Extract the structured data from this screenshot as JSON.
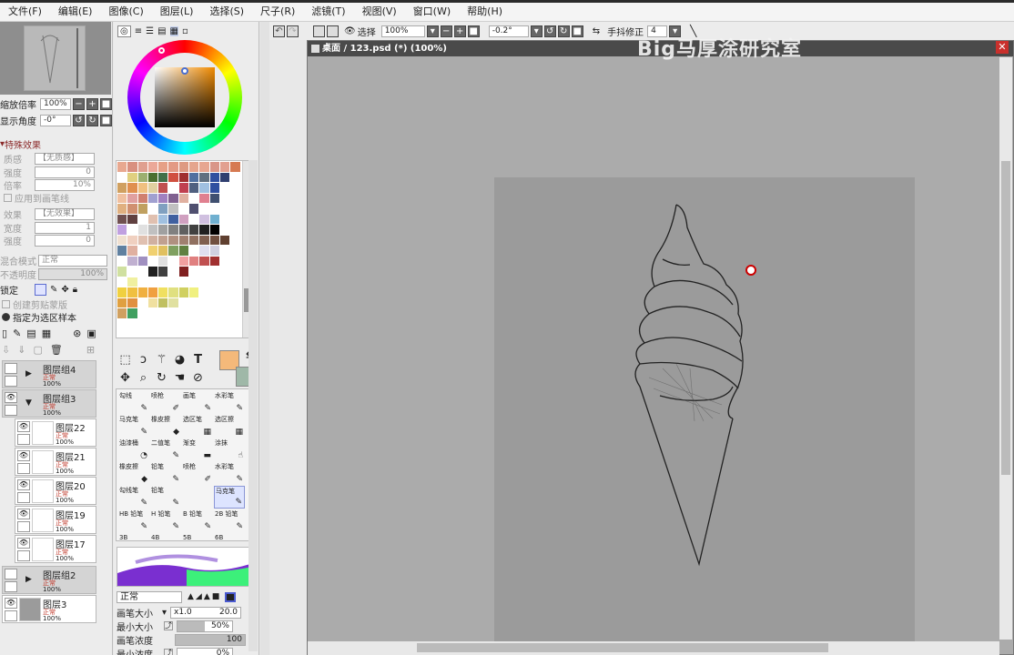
{
  "menu": [
    "文件(F)",
    "编辑(E)",
    "图像(C)",
    "图层(L)",
    "选择(S)",
    "尺子(R)",
    "滤镜(T)",
    "视图(V)",
    "窗口(W)",
    "帮助(H)"
  ],
  "navigator": {
    "zoom_label": "缩放倍率",
    "zoom_value": "100%",
    "angle_label": "显示角度",
    "angle_value": "-0°"
  },
  "effects": {
    "header": "特殊效果",
    "texture_label": "质感",
    "texture_value": "【无质感】",
    "intensity_label": "强度",
    "intensity_value": "0",
    "scale_label": "倍率",
    "scale_value": "10%",
    "apply_brush": "应用到画笔线",
    "effect_label": "效果",
    "effect_value": "【无效果】",
    "width_label": "宽度",
    "width_value": "1",
    "intensity2_label": "强度",
    "intensity2_value": "0"
  },
  "blending": {
    "mode_label": "混合模式",
    "mode_value": "正常",
    "opacity_label": "不透明度",
    "opacity_value": "100%",
    "lock_label": "锁定",
    "clip_label": "创建剪贴蒙版",
    "sample_label": "指定为选区样本"
  },
  "layers": [
    {
      "name": "图层组4",
      "mode": "正常",
      "opacity": "100%",
      "group": true
    },
    {
      "name": "图层组3",
      "mode": "正常",
      "opacity": "100%",
      "group": true
    },
    {
      "name": "图层22",
      "mode": "正常",
      "opacity": "100%",
      "group": false
    },
    {
      "name": "图层21",
      "mode": "正常",
      "opacity": "100%",
      "group": false
    },
    {
      "name": "图层20",
      "mode": "正常",
      "opacity": "100%",
      "group": false
    },
    {
      "name": "图层19",
      "mode": "正常",
      "opacity": "100%",
      "group": false
    },
    {
      "name": "图层17",
      "mode": "正常",
      "opacity": "100%",
      "group": false
    },
    {
      "name": "图层组2",
      "mode": "正常",
      "opacity": "100%",
      "group": true
    },
    {
      "name": "图层3",
      "mode": "正常",
      "opacity": "100%",
      "group": false
    }
  ],
  "swatch_colors": [
    "#e8a890",
    "#d99080",
    "#e0a090",
    "#eba898",
    "#e6a086",
    "#e39a84",
    "#de9a82",
    "#e5a58d",
    "#e7a690",
    "#d99688",
    "#e2a090",
    "#d67a52",
    "#ffffff",
    "#e0d080",
    "#9cb070",
    "#4a7030",
    "#407048",
    "#d05040",
    "#a03030",
    "#5070a0",
    "#607080",
    "#3050a0",
    "#304070",
    "#ffffff",
    "#d0a060",
    "#e09050",
    "#f0c080",
    "#e0d0a0",
    "#c05050",
    "#ffffff",
    "#c04050",
    "#506080",
    "#a0c0e0",
    "#3050a0",
    "#ffffff",
    "#ffffff",
    "#f0c0a0",
    "#e0a0a0",
    "#d08070",
    "#a0a0d0",
    "#a080c0",
    "#806090",
    "#e0b0a0",
    "#ffffff",
    "#e08090",
    "#405070",
    "#ffffff",
    "#ffffff",
    "#e0b080",
    "#d09070",
    "#c0a060",
    "#ffffff",
    "#80a0c0",
    "#c0c0c0",
    "#ffffff",
    "#505070",
    "#ffffff",
    "#ffffff",
    "#ffffff",
    "#ffffff",
    "#705050",
    "#604040",
    "#ffffff",
    "#e0c0b0",
    "#a0c0e0",
    "#4060a0",
    "#d0a0c0",
    "#ffffff",
    "#d0c0e0",
    "#70b0d0",
    "#ffffff",
    "#ffffff",
    "#c0a0e0",
    "#ffffff",
    "#e0e0e0",
    "#c0c0c0",
    "#a0a0a0",
    "#808080",
    "#606060",
    "#404040",
    "#202020",
    "#000000",
    "#ffffff",
    "#ffffff",
    "#f0e0d0",
    "#f0d0c0",
    "#e0c0b0",
    "#d0b0a0",
    "#c0a090",
    "#b09080",
    "#a08070",
    "#907060",
    "#806050",
    "#705040",
    "#604030",
    "#ffffff",
    "#6080a0",
    "#e0b0a0",
    "#ffffff",
    "#f0d070",
    "#e0c060",
    "#80a060",
    "#608040",
    "#ffffff",
    "#e0e0f0",
    "#d0d0e0",
    "#ffffff",
    "#ffffff",
    "#ffffff",
    "#c0b0d0",
    "#a090c0",
    "#ffffff",
    "#e0e0e0",
    "#ffffff",
    "#f0a0a0",
    "#e08080",
    "#c05050",
    "#a03030",
    "#ffffff",
    "#ffffff",
    "#d0e0a0",
    "#ffffff",
    "#ffffff",
    "#202020",
    "#404040",
    "#ffffff",
    "#802020",
    "#ffffff",
    "#ffffff",
    "#ffffff",
    "#ffffff",
    "#ffffff",
    "#ffffff",
    "#f0f0a0",
    "#ffffff",
    "#ffffff",
    "#ffffff",
    "#ffffff",
    "#ffffff",
    "#ffffff",
    "#ffffff",
    "#ffffff",
    "#ffffff",
    "#ffffff",
    "#f0d040",
    "#f0c040",
    "#f0b040",
    "#f0a040",
    "#f0e060",
    "#e0e080",
    "#d0d060",
    "#f0f080",
    "#ffffff",
    "#ffffff",
    "#ffffff",
    "#ffffff",
    "#e0a040",
    "#e09040",
    "#ffffff",
    "#f0e0a0",
    "#c0c060",
    "#e0e0a0",
    "#ffffff",
    "#ffffff",
    "#ffffff",
    "#ffffff",
    "#ffffff",
    "#ffffff",
    "#d0a060",
    "#40a060",
    "#ffffff",
    "#ffffff",
    "#ffffff",
    "#ffffff",
    "#ffffff",
    "#ffffff",
    "#ffffff",
    "#ffffff",
    "#ffffff",
    "#ffffff"
  ],
  "colors": {
    "primary": "#f4b97a",
    "secondary": "#9fb8a8",
    "accent_red": "#c9302c"
  },
  "brushes": [
    {
      "name": "勾线",
      "icon": "✎"
    },
    {
      "name": "喷枪",
      "icon": "✐"
    },
    {
      "name": "画笔",
      "icon": "✎"
    },
    {
      "name": "水彩笔",
      "icon": "✎"
    },
    {
      "name": "马克笔",
      "icon": "✎"
    },
    {
      "name": "橡皮擦",
      "icon": "◆"
    },
    {
      "name": "选区笔",
      "icon": "▦"
    },
    {
      "name": "选区擦",
      "icon": "▦"
    },
    {
      "name": "油漆桶",
      "icon": "◔"
    },
    {
      "name": "二值笔",
      "icon": "✎"
    },
    {
      "name": "渐变",
      "icon": "▬"
    },
    {
      "name": "涂抹",
      "icon": "☝"
    },
    {
      "name": "橡皮擦",
      "icon": "◆"
    },
    {
      "name": "铅笔",
      "icon": "✎"
    },
    {
      "name": "喷枪",
      "icon": "✐"
    },
    {
      "name": "水彩笔",
      "icon": "✎"
    },
    {
      "name": "勾线笔",
      "icon": "✎"
    },
    {
      "name": "铅笔",
      "icon": "✎"
    },
    {
      "name": "",
      "icon": ""
    },
    {
      "name": "马克笔",
      "icon": "✎"
    },
    {
      "name": "HB 铅笔",
      "icon": "✎"
    },
    {
      "name": "H 铅笔",
      "icon": "✎"
    },
    {
      "name": "B 铅笔",
      "icon": "✎"
    },
    {
      "name": "2B 铅笔",
      "icon": "✎"
    },
    {
      "name": "3B",
      "icon": ""
    },
    {
      "name": "4B",
      "icon": ""
    },
    {
      "name": "5B",
      "icon": ""
    },
    {
      "name": "6B",
      "icon": ""
    }
  ],
  "brush_settings": {
    "mode": "正常",
    "size_label": "画笔大小",
    "size_mult": "x1.0",
    "size_value": "20.0",
    "min_size_label": "最小大小",
    "min_size_value": "50%",
    "density_label": "画笔浓度",
    "density_value": "100",
    "min_density_label": "最小浓度",
    "min_density_value": "0%"
  },
  "toolbar": {
    "select_label": "选择",
    "zoom_value": "100%",
    "rotation_value": "-0.2°",
    "stabilizer_label": "手抖修正",
    "stabilizer_value": "4"
  },
  "document": {
    "title": "桌面 / 123.psd (*) (100%)"
  },
  "watermark": "Big马厚涂研究室"
}
